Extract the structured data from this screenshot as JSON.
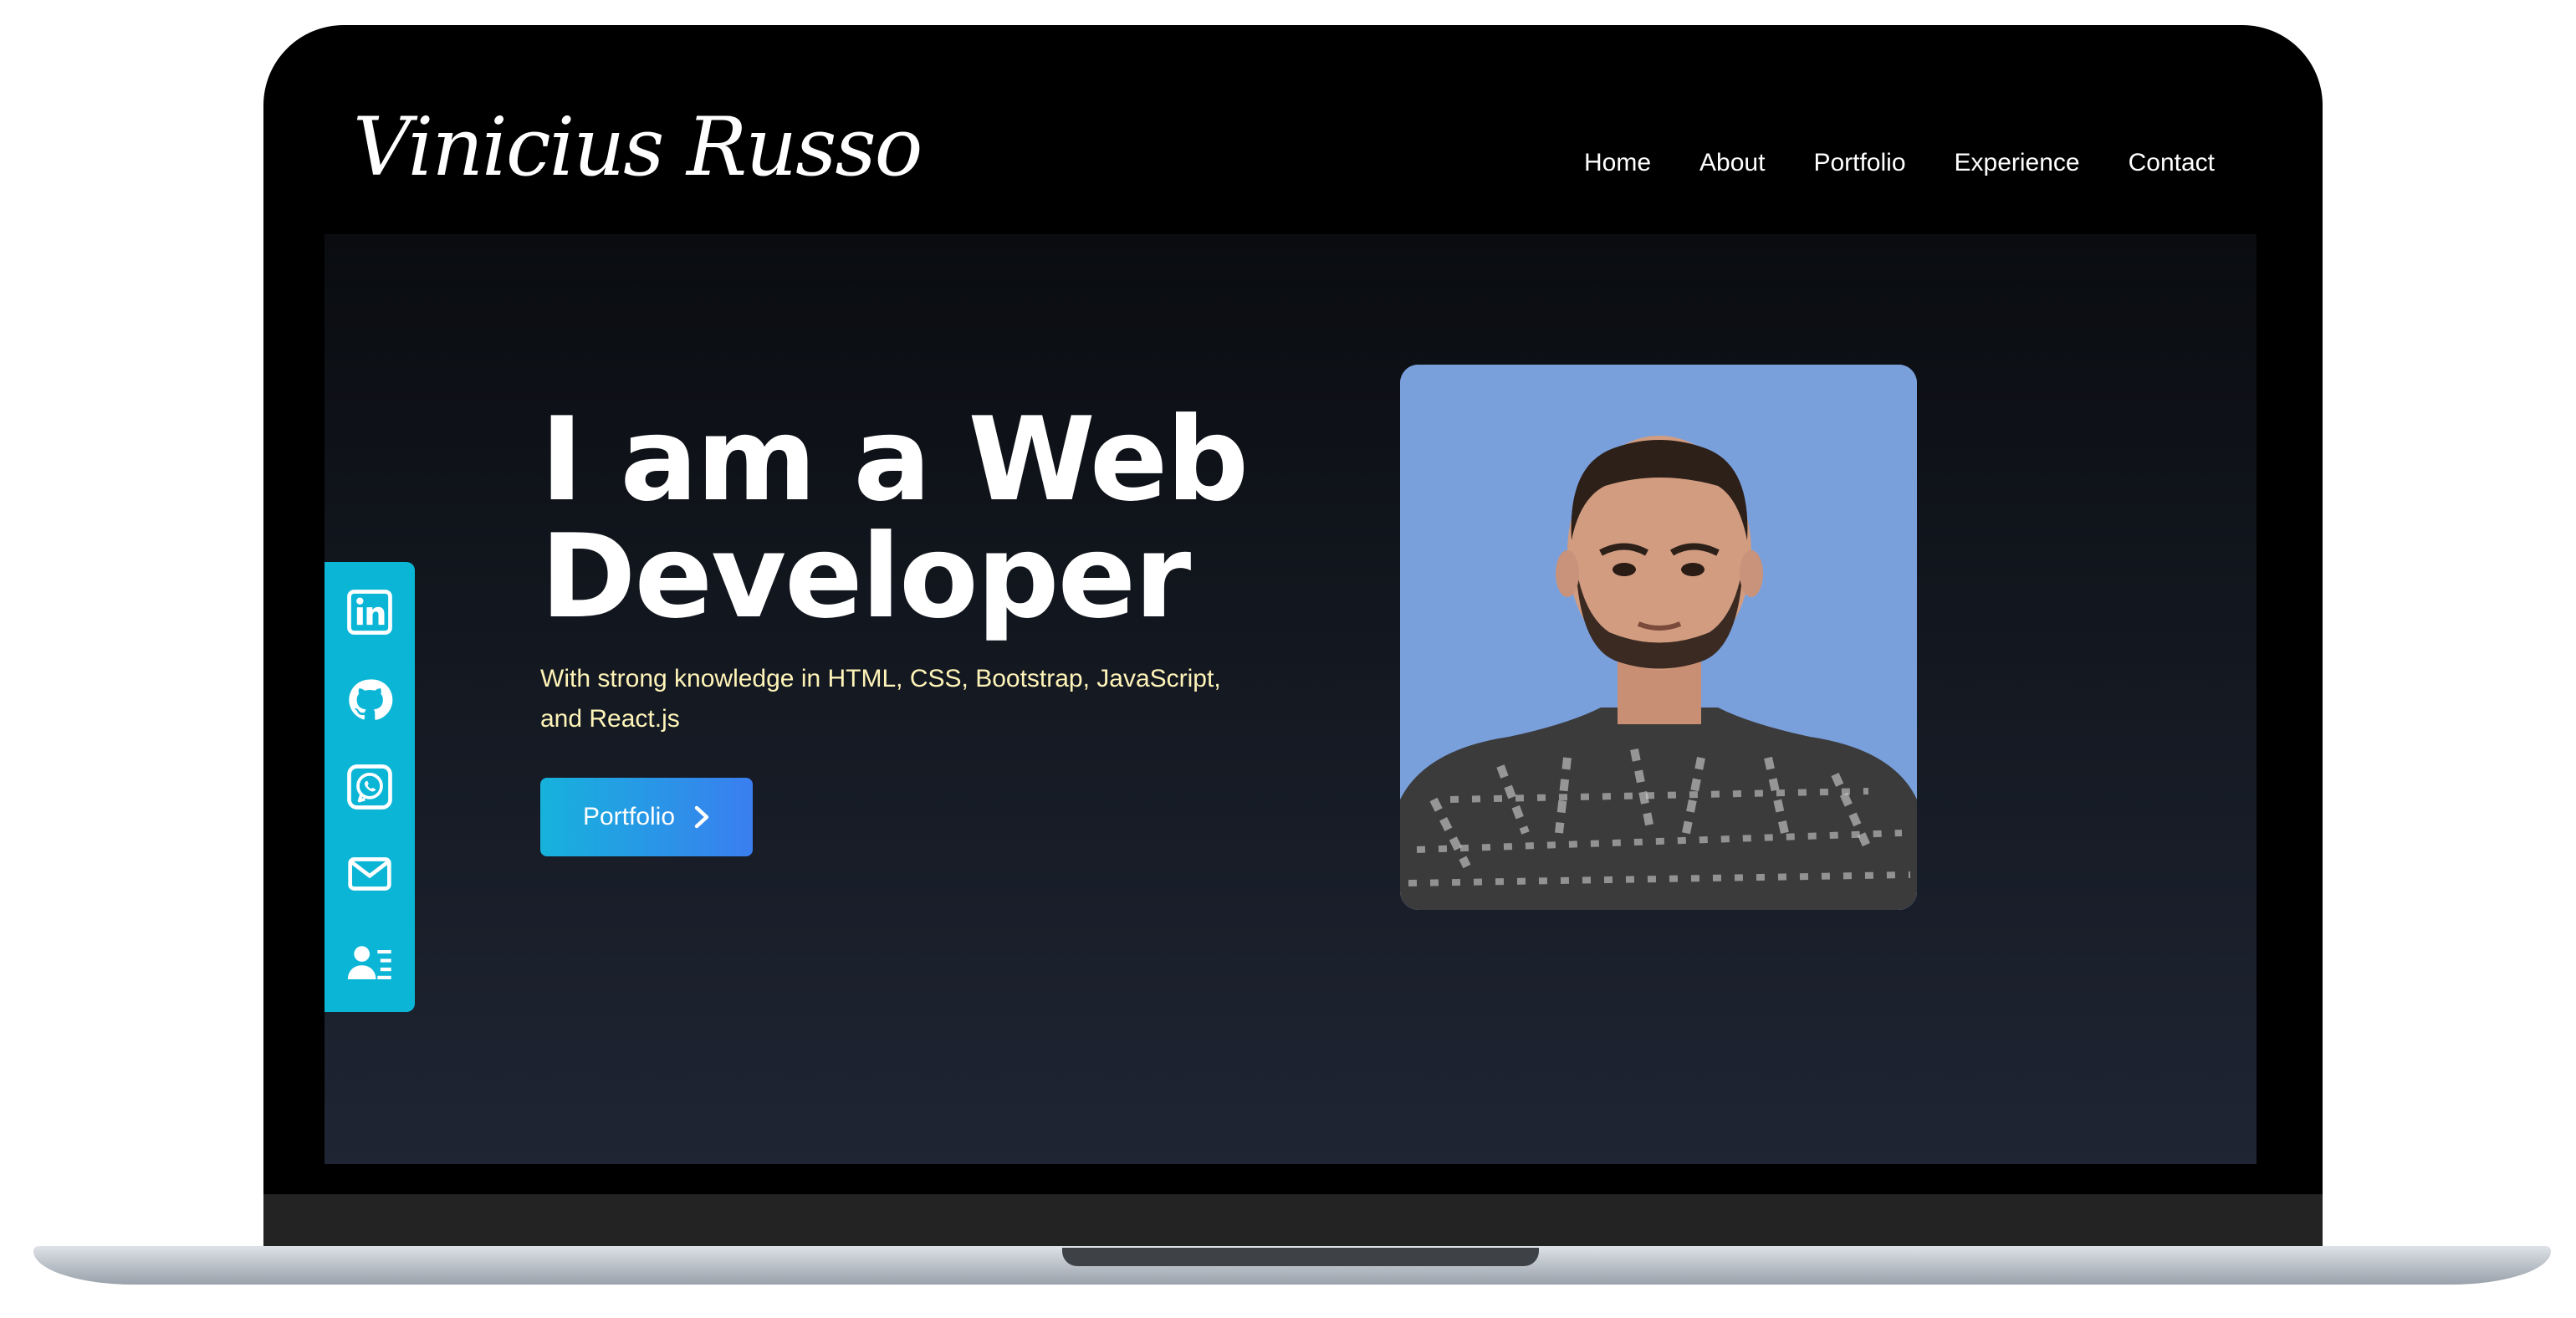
{
  "brand": {
    "name": "Vinicius Russo"
  },
  "nav": {
    "items": [
      "Home",
      "About",
      "Portfolio",
      "Experience",
      "Contact"
    ]
  },
  "hero": {
    "headline_line1": "I am a Web",
    "headline_line2": "Developer",
    "subtitle": "With strong knowledge in HTML, CSS, Bootstrap, JavaScript, and React.js",
    "cta_label": "Portfolio"
  },
  "social": [
    "linkedin-icon",
    "github-icon",
    "whatsapp-icon",
    "email-icon",
    "contact-card-icon"
  ],
  "colors": {
    "accent": "#0bb5d6",
    "cta_gradient_start": "#16b2dc",
    "cta_gradient_end": "#3a7ef0",
    "subtitle": "#fff4b8",
    "background_top": "#0a0c10",
    "background_bottom": "#1f2533"
  }
}
